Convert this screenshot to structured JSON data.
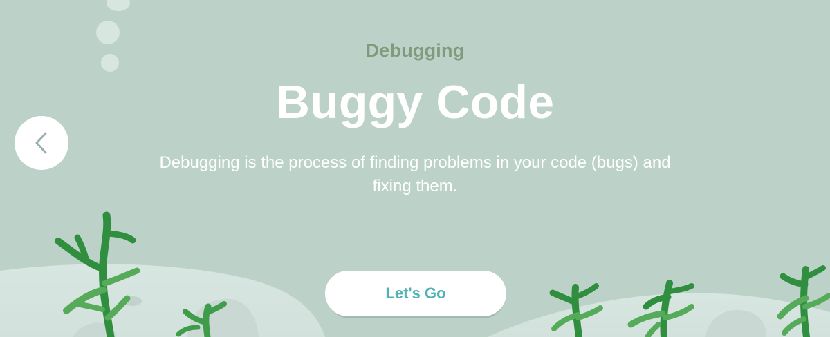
{
  "screen": {
    "eyebrow": "Debugging",
    "title": "Buggy Code",
    "description": "Debugging is the process of finding problems in your code (bugs) and fixing them.",
    "cta_label": "Let's Go",
    "back_icon": "chevron-left-icon"
  },
  "colors": {
    "background": "#bcd2c9",
    "eyebrow": "#7f9b7c",
    "title": "#ffffff",
    "button_text": "#4fb2b5",
    "seabed": "#d8e6e2",
    "seaweed_dark": "#2f8f3f",
    "seaweed_light": "#56ab5a"
  }
}
